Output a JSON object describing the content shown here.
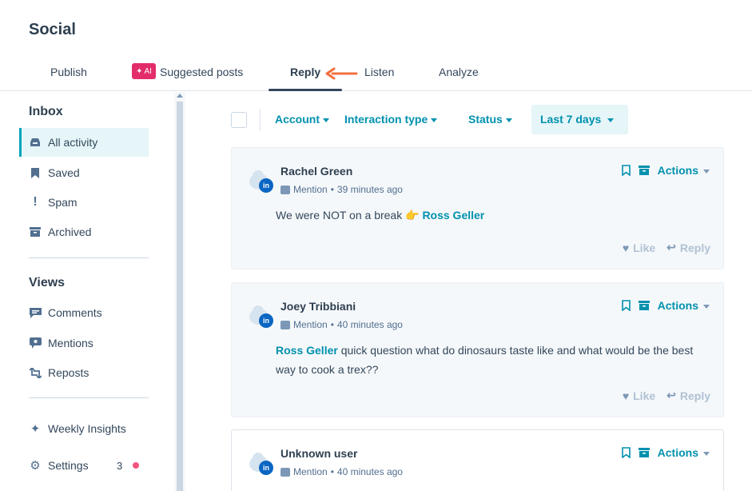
{
  "page": {
    "title": "Social"
  },
  "tabs": [
    {
      "label": "Publish"
    },
    {
      "badge": "AI",
      "label": "Suggested posts"
    },
    {
      "label": "Reply"
    },
    {
      "label": "Listen"
    },
    {
      "label": "Analyze"
    }
  ],
  "sidebar": {
    "inbox_heading": "Inbox",
    "inbox_items": [
      {
        "label": "All activity",
        "icon": "inbox-icon"
      },
      {
        "label": "Saved",
        "icon": "bookmark-icon"
      },
      {
        "label": "Spam",
        "icon": "exclamation-icon"
      },
      {
        "label": "Archived",
        "icon": "archive-icon"
      }
    ],
    "views_heading": "Views",
    "view_items": [
      {
        "label": "Comments",
        "icon": "comment-icon"
      },
      {
        "label": "Mentions",
        "icon": "mention-icon"
      },
      {
        "label": "Reposts",
        "icon": "repost-icon"
      }
    ],
    "bottom_items": [
      {
        "label": "Weekly Insights",
        "icon": "sparkle-icon"
      },
      {
        "label": "Settings",
        "icon": "gear-icon",
        "count": "3"
      }
    ]
  },
  "filters": {
    "account": "Account",
    "interaction_type": "Interaction type",
    "status": "Status",
    "date_range": "Last 7 days"
  },
  "cards": [
    {
      "author": "Rachel Green",
      "type": "Mention",
      "time": "39 minutes ago",
      "text_before": "We were NOT on a break 👉 ",
      "mention": "Ross Geller",
      "text_after": "",
      "actions": "Actions",
      "like": "Like",
      "reply": "Reply"
    },
    {
      "author": "Joey Tribbiani",
      "type": "Mention",
      "time": "40 minutes ago",
      "mention": "Ross Geller",
      "text_after": " quick question what do dinosaurs taste like and what would be the best way to cook a trex??",
      "actions": "Actions",
      "like": "Like",
      "reply": "Reply"
    },
    {
      "author": "Unknown user",
      "type": "Mention",
      "time": "40 minutes ago",
      "actions": "Actions"
    }
  ],
  "colors": {
    "accent": "#0091ae",
    "ai_badge": "#e32d6b",
    "arrow": "#f2703f",
    "dot": "#f2547d"
  }
}
